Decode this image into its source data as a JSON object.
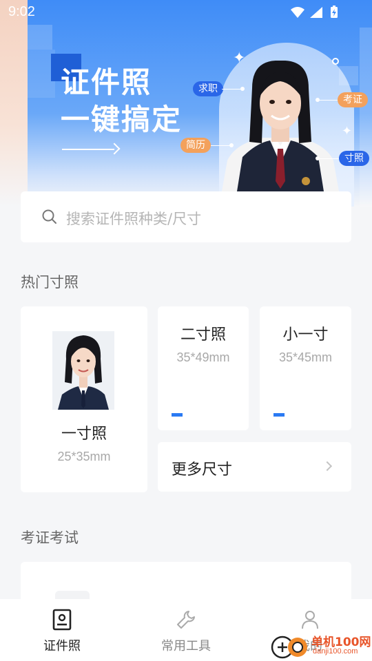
{
  "status_bar": {
    "time": "9:02"
  },
  "banner": {
    "headline_1": "证件照",
    "headline_2": "一键搞定",
    "tags": {
      "job": "求职",
      "exam": "考证",
      "resume": "简历",
      "size": "寸照"
    }
  },
  "search": {
    "placeholder": "搜索证件照种类/尺寸"
  },
  "hot_section": {
    "title": "热门寸照",
    "cards": [
      {
        "title": "一寸照",
        "size": "25*35mm"
      },
      {
        "title": "二寸照",
        "size": "35*49mm"
      },
      {
        "title": "小一寸",
        "size": "35*45mm"
      }
    ],
    "more_label": "更多尺寸"
  },
  "exam_section": {
    "title": "考证考试"
  },
  "bottom_nav": {
    "items": [
      {
        "label": "证件照",
        "icon": "id-photo-icon",
        "active": true
      },
      {
        "label": "常用工具",
        "icon": "wrench-icon",
        "active": false
      },
      {
        "label": "我的",
        "icon": "user-icon",
        "active": false
      }
    ]
  },
  "watermark": {
    "brand": "单机100网",
    "url": "danji100.com"
  },
  "colors": {
    "accent": "#2a7af3",
    "tag_blue": "#2a66e8",
    "tag_orange": "#f3a15c",
    "brand_watermark": "#e8552a"
  }
}
